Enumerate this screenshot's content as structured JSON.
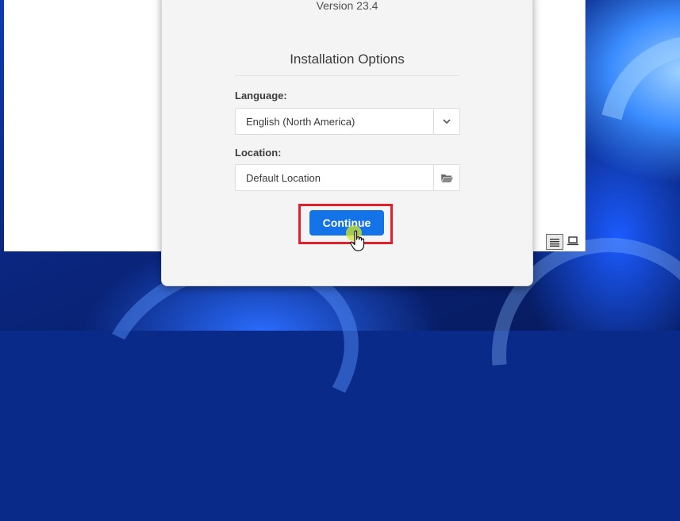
{
  "installer": {
    "version_text": "Version 23.4",
    "section_title": "Installation Options",
    "language": {
      "label": "Language:",
      "value": "English (North America)"
    },
    "location": {
      "label": "Location:",
      "value": "Default Location"
    },
    "continue_label": "Continue"
  },
  "icons": {
    "language_dropdown": "chevron-down-icon",
    "location_browse": "folder-icon",
    "view_list": "list-view-icon",
    "view_screen": "screen-view-icon"
  },
  "colors": {
    "accent": "#1473e6",
    "highlight": "#e0212b",
    "dialog_bg": "#f4f4f4"
  }
}
